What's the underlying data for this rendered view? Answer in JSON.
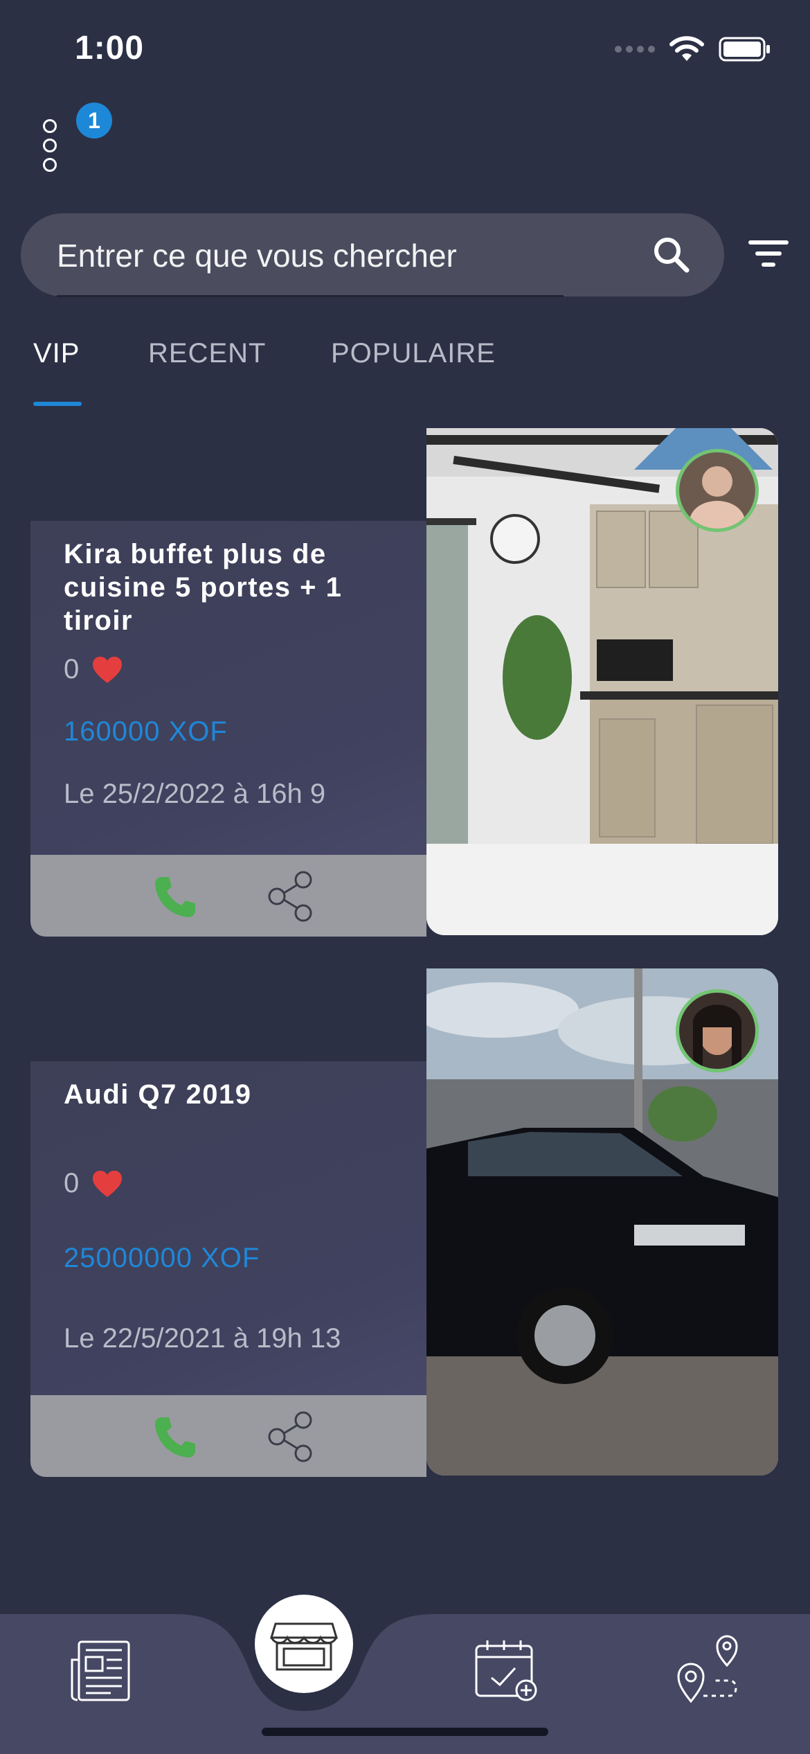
{
  "status_bar": {
    "time": "1:00"
  },
  "header": {
    "notification_count": "1"
  },
  "search": {
    "placeholder": "Entrer ce que vous chercher"
  },
  "tabs": [
    {
      "label": "VIP",
      "active": true
    },
    {
      "label": "RECENT",
      "active": false
    },
    {
      "label": "POPULAIRE",
      "active": false
    }
  ],
  "listings": [
    {
      "title": "Kira buffet plus de cuisine 5 portes + 1 tiroir",
      "likes": "0",
      "price": "160000 XOF",
      "date": "Le 25/2/2022 à 16h 9",
      "photo": "kitchen-buffet-photo"
    },
    {
      "title": "Audi Q7 2019",
      "likes": "0",
      "price": "25000000 XOF",
      "date": "Le 22/5/2021 à 19h 13",
      "photo": "black-suv-photo"
    }
  ],
  "bottom_nav": [
    "news-icon",
    "shop-icon",
    "calendar-icon",
    "map-route-icon"
  ],
  "colors": {
    "background": "#2c3045",
    "accent": "#1e88d8",
    "heart": "#e53e3e",
    "phone": "#4caf50",
    "active_ring": "#72c572"
  }
}
